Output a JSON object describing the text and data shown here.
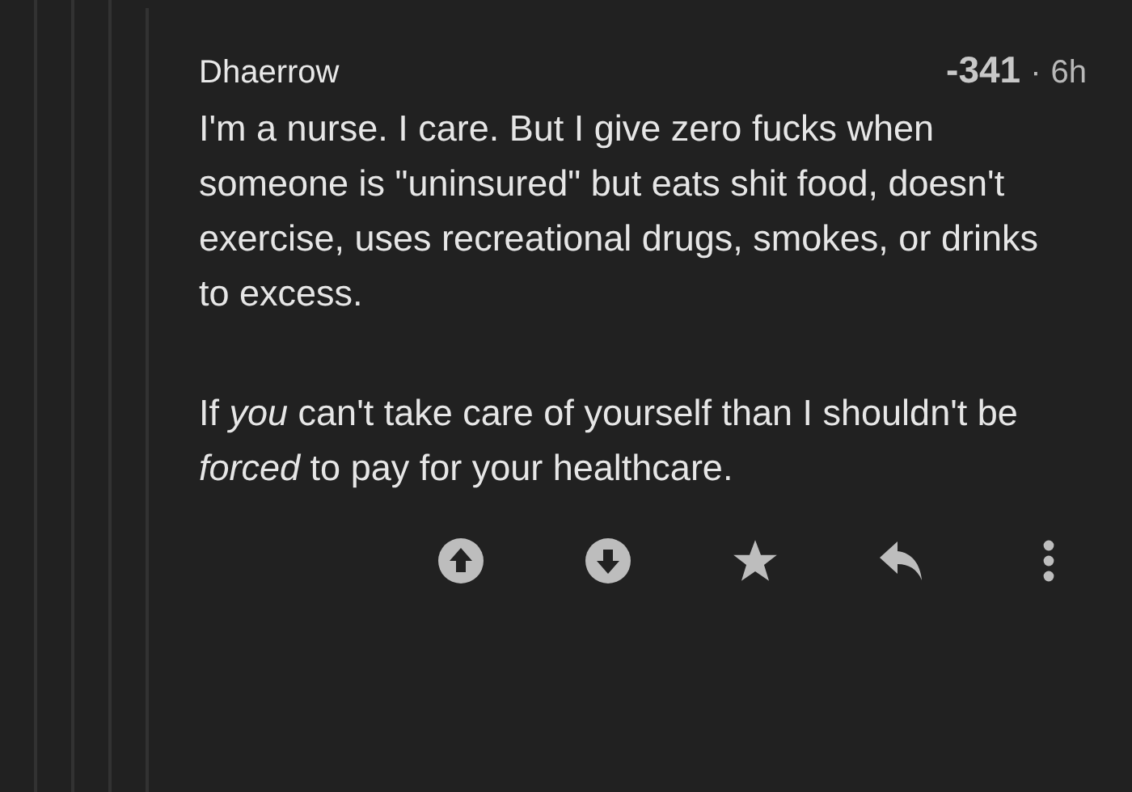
{
  "comment": {
    "author": "Dhaerrow",
    "score": "-341",
    "separator": "·",
    "age": "6h",
    "paragraphs": [
      "I'm a nurse. I care. But I give zero fucks when someone is \"uninsured\" but eats shit food, doesn't exercise, uses recreational drugs, smokes, or drinks to excess.",
      "If *you* can't take care of yourself than I shouldn't be *forced* to pay for your healthcare."
    ],
    "actions": [
      {
        "kind": "upvote"
      },
      {
        "kind": "downvote"
      },
      {
        "kind": "save"
      },
      {
        "kind": "reply"
      },
      {
        "kind": "more"
      }
    ]
  },
  "thread_depth": [
    {
      "kind": "guide"
    },
    {
      "kind": "guide"
    },
    {
      "kind": "guide"
    },
    {
      "kind": "guide"
    }
  ]
}
